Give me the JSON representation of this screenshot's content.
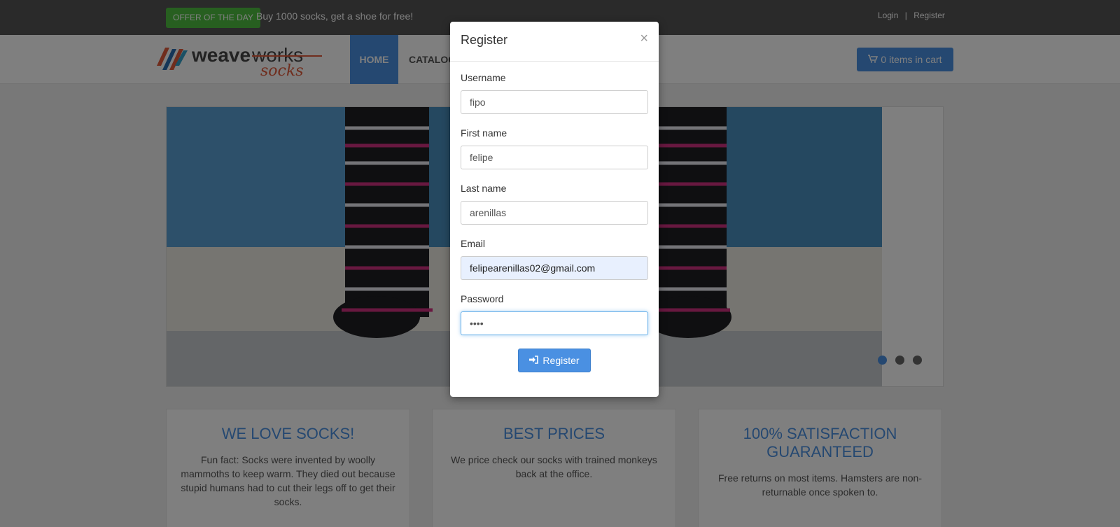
{
  "topbar": {
    "offer_badge": "OFFER OF THE DAY",
    "offer_text": "Buy 1000 socks, get a shoe for free!",
    "login": "Login",
    "separator": "|",
    "register": "Register"
  },
  "navbar": {
    "home": "HOME",
    "catalogue": "CATALOG",
    "cart": "0 items in cart",
    "cart_icon": "shopping-cart-icon"
  },
  "slider": {
    "dots": 3,
    "active_dot": 1
  },
  "features": [
    {
      "title": "WE LOVE SOCKS!",
      "text": "Fun fact: Socks were invented by woolly mammoths to keep warm. They died out because stupid humans had to cut their legs off to get their socks."
    },
    {
      "title": "BEST PRICES",
      "text": "We price check our socks with trained monkeys back at the office."
    },
    {
      "title": "100% SATISFACTION GUARANTEED",
      "text": "Free returns on most items. Hamsters are non-returnable once spoken to."
    }
  ],
  "modal": {
    "title": "Register",
    "close": "×",
    "fields": {
      "username": {
        "label": "Username",
        "value": "fipo"
      },
      "first_name": {
        "label": "First name",
        "value": "felipe"
      },
      "last_name": {
        "label": "Last name",
        "value": "arenillas"
      },
      "email": {
        "label": "Email",
        "value": "felipearenillas02@gmail.com"
      },
      "password": {
        "label": "Password",
        "value": "abcd"
      }
    },
    "submit": "Register",
    "submit_icon": "sign-in-icon"
  },
  "colors": {
    "primary": "#4a90e2",
    "offer_green": "#4fbf40",
    "topbar": "#555555"
  }
}
